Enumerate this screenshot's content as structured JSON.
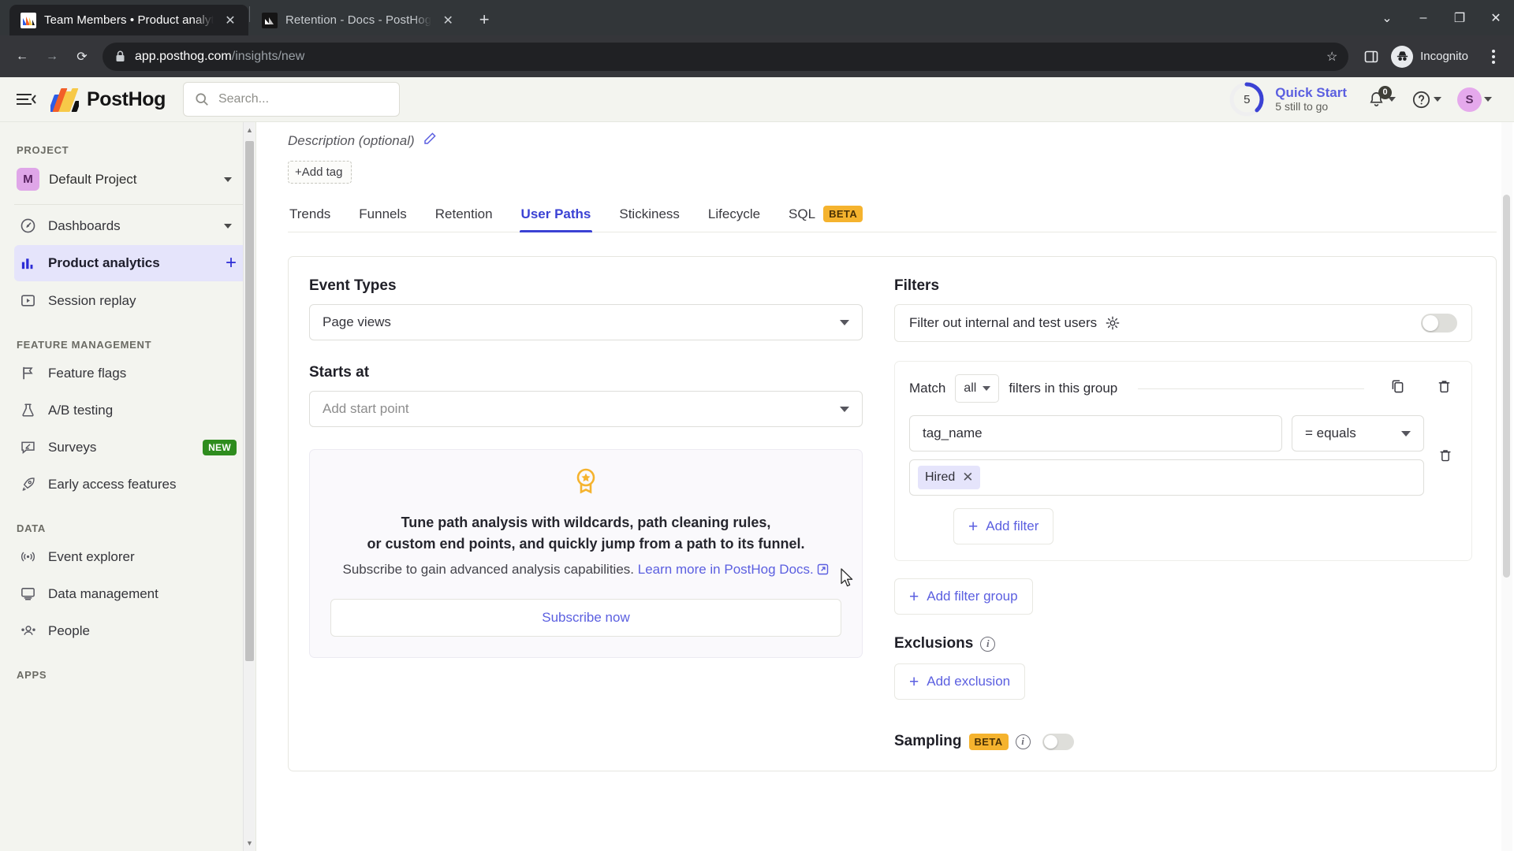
{
  "browser": {
    "tabs": [
      {
        "title": "Team Members • Product analytics",
        "favicon": "posthog-favicon",
        "active": true,
        "close_label": "✕"
      },
      {
        "title": "Retention - Docs - PostHog",
        "favicon": "posthog-docs-favicon",
        "active": false,
        "close_label": "✕"
      }
    ],
    "new_tab_label": "+",
    "window_controls": {
      "tab_search": "⌄",
      "minimize": "–",
      "maximize": "❐",
      "close": "✕"
    },
    "nav": {
      "back": "←",
      "forward": "→",
      "reload": "⟳"
    },
    "address": {
      "lock_icon": "lock-icon",
      "host": "app.posthog.com",
      "path": "/insights/new"
    },
    "star_label": "☆",
    "side_panel_label": "▣",
    "profile": {
      "label": "Incognito",
      "icon": "incognito-icon"
    },
    "menu_label": "⋮"
  },
  "topbar": {
    "menu_toggle_label": "≡",
    "brand": "PostHog",
    "search": {
      "placeholder": "Search...",
      "value": "",
      "icon": "search-icon"
    },
    "quick_start": {
      "count": "5",
      "title": "Quick Start",
      "subtitle": "5 still to go",
      "progress_percent": 37.5
    },
    "notifications": {
      "count": "0",
      "icon": "bell-icon"
    },
    "help": {
      "icon": "question-circle-icon"
    },
    "account": {
      "initial": "S"
    }
  },
  "sidebar": {
    "sections": [
      {
        "title": "PROJECT",
        "project": {
          "badge": "M",
          "name": "Default Project",
          "icon": "chevron-down-icon"
        },
        "items": []
      },
      {
        "title": "",
        "items": [
          {
            "label": "Dashboards",
            "icon": "gauge-icon",
            "active": false,
            "trailing": "chevron-down-icon"
          },
          {
            "label": "Product analytics",
            "icon": "bar-chart-icon",
            "active": true,
            "trailing": "plus-icon"
          },
          {
            "label": "Session replay",
            "icon": "play-box-icon",
            "active": false,
            "trailing": ""
          }
        ]
      },
      {
        "title": "FEATURE MANAGEMENT",
        "items": [
          {
            "label": "Feature flags",
            "icon": "flag-icon",
            "active": false,
            "trailing": ""
          },
          {
            "label": "A/B testing",
            "icon": "flask-icon",
            "active": false,
            "trailing": ""
          },
          {
            "label": "Surveys",
            "icon": "survey-icon",
            "active": false,
            "trailing": "",
            "badge": "NEW"
          },
          {
            "label": "Early access features",
            "icon": "rocket-icon",
            "active": false,
            "trailing": ""
          }
        ]
      },
      {
        "title": "DATA",
        "items": [
          {
            "label": "Event explorer",
            "icon": "broadcast-icon",
            "active": false,
            "trailing": ""
          },
          {
            "label": "Data management",
            "icon": "monitor-icon",
            "active": false,
            "trailing": ""
          },
          {
            "label": "People",
            "icon": "people-icon",
            "active": false,
            "trailing": ""
          }
        ]
      },
      {
        "title": "APPS",
        "items": []
      }
    ]
  },
  "insight": {
    "description_placeholder": "Description (optional)",
    "edit_icon": "pencil-icon",
    "add_tag_label": "+Add tag",
    "tabs": [
      {
        "label": "Trends",
        "selected": false
      },
      {
        "label": "Funnels",
        "selected": false
      },
      {
        "label": "Retention",
        "selected": false
      },
      {
        "label": "User Paths",
        "selected": true
      },
      {
        "label": "Stickiness",
        "selected": false
      },
      {
        "label": "Lifecycle",
        "selected": false
      },
      {
        "label": "SQL",
        "selected": false,
        "badge": "BETA"
      }
    ]
  },
  "left_column": {
    "event_types": {
      "label": "Event Types",
      "value": "Page views"
    },
    "starts_at": {
      "label": "Starts at",
      "placeholder": "Add start point"
    },
    "promo": {
      "icon": "award-ribbon-icon",
      "headline_line1": "Tune path analysis with wildcards, path cleaning rules,",
      "headline_line2": "or custom end points, and quickly jump from a path to its funnel.",
      "body": "Subscribe to gain advanced analysis capabilities.",
      "link_text": "Learn more in PostHog Docs.",
      "link_icon": "external-link-icon",
      "cta_label": "Subscribe now"
    }
  },
  "right_column": {
    "filters_label": "Filters",
    "internal_users": {
      "label": "Filter out internal and test users",
      "settings_icon": "gear-icon",
      "enabled": false
    },
    "filter_group": {
      "match_prefix": "Match",
      "match_value": "all",
      "match_suffix": "filters in this group",
      "duplicate_icon": "copy-icon",
      "delete_icon": "trash-icon",
      "rows": [
        {
          "property": "tag_name",
          "operator": "= equals",
          "values": [
            "Hired"
          ],
          "remove_value_icon": "close-icon",
          "delete_icon": "trash-icon"
        }
      ],
      "add_filter_label": "Add filter"
    },
    "add_filter_group_label": "Add filter group",
    "exclusions": {
      "label": "Exclusions",
      "info_icon": "info-icon",
      "add_label": "Add exclusion"
    },
    "sampling": {
      "label": "Sampling",
      "badge": "BETA",
      "info_icon": "info-icon",
      "enabled": false
    }
  },
  "colors": {
    "accent": "#5b5fe0",
    "accent_strong": "#3b42d4",
    "beta_badge": "#f5b32e",
    "new_badge": "#2e8c1e",
    "sidebar_bg": "#f3f4ef",
    "active_nav_bg": "#e5e4fb",
    "avatar_bg": "#e5a9ec"
  }
}
